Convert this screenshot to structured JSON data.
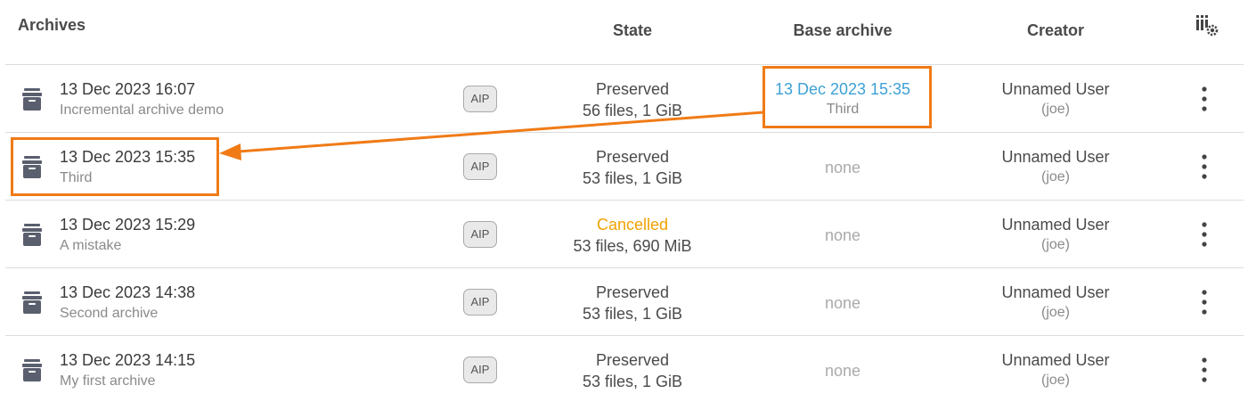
{
  "header": {
    "archives": "Archives",
    "state": "State",
    "base_archive": "Base archive",
    "creator": "Creator"
  },
  "icons": {
    "archive": "archive-box-icon",
    "settings": "column-settings-icon",
    "menu": "vertical-dots-icon"
  },
  "colors": {
    "highlight": "#f07b16",
    "link": "#3da1d6",
    "cancelled": "#f0a100"
  },
  "rows": [
    {
      "title": "13 Dec 2023 16:07",
      "description": "Incremental archive demo",
      "badge": "AIP",
      "state": "Preserved",
      "size": "56 files, 1 GiB",
      "base_title": "13 Dec 2023 15:35",
      "base_sub": "Third",
      "base_none": "",
      "creator": "Unnamed User",
      "login": "(joe)"
    },
    {
      "title": "13 Dec 2023 15:35",
      "description": "Third",
      "badge": "AIP",
      "state": "Preserved",
      "size": "53 files, 1 GiB",
      "base_none": "none",
      "creator": "Unnamed User",
      "login": "(joe)"
    },
    {
      "title": "13 Dec 2023 15:29",
      "description": "A mistake",
      "badge": "AIP",
      "state": "Cancelled",
      "size": "53 files, 690 MiB",
      "base_none": "none",
      "creator": "Unnamed User",
      "login": "(joe)"
    },
    {
      "title": "13 Dec 2023 14:38",
      "description": "Second archive",
      "badge": "AIP",
      "state": "Preserved",
      "size": "53 files, 1 GiB",
      "base_none": "none",
      "creator": "Unnamed User",
      "login": "(joe)"
    },
    {
      "title": "13 Dec 2023 14:15",
      "description": "My first archive",
      "badge": "AIP",
      "state": "Preserved",
      "size": "53 files, 1 GiB",
      "base_none": "none",
      "creator": "Unnamed User",
      "login": "(joe)"
    }
  ]
}
